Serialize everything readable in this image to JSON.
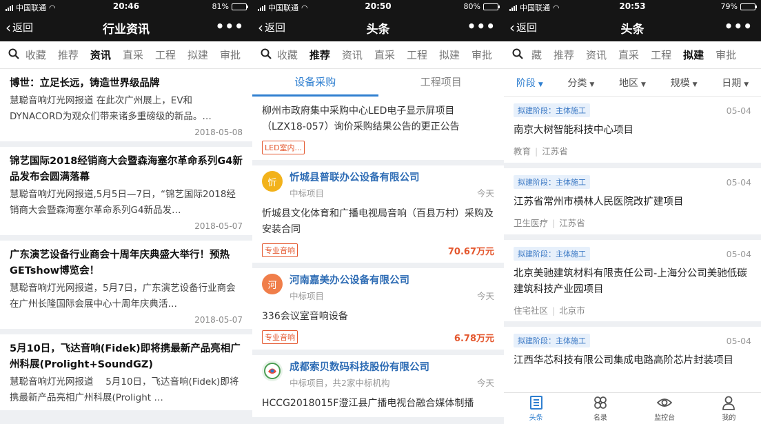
{
  "screens": [
    {
      "status": {
        "carrier": "中国联通",
        "time": "20:46",
        "battery": "81%",
        "battery_level": 0.81
      },
      "nav": {
        "back": "返回",
        "title": "行业资讯",
        "more": "•••"
      },
      "cats": [
        "收藏",
        "推荐",
        "资讯",
        "直采",
        "工程",
        "拟建",
        "审批"
      ],
      "active_cat": "资讯",
      "news": [
        {
          "title": "博世：立足长远，铸造世界级品牌",
          "desc": "慧聪音响灯光网报道 在此次广州展上，EV和DYNACORD为观众们带来诸多重磅级的新品。…",
          "date": "2018-05-08"
        },
        {
          "title": "锦艺国际2018经销商大会暨森海塞尔革命系列G4新品发布会圆满落幕",
          "desc": "慧聪音响灯光网报道,5月5日—7日，“锦艺国际2018经销商大会暨森海塞尔革命系列G4新品发…",
          "date": "2018-05-07"
        },
        {
          "title": "广东演艺设备行业商会十周年庆典盛大举行！预热GETshow博览会！",
          "desc": "慧聪音响灯光网报道，5月7日，广东演艺设备行业商会在广州长隆国际会展中心十周年庆典活…",
          "date": "2018-05-07"
        },
        {
          "title": "5月10日，飞达音响(Fidek)即将携最新产品亮相广州科展(Prolight+SoundGZ)",
          "desc": "慧聪音响灯光网报道　 5月10日，飞达音响(Fidek)即将携最新产品亮相广州科展(Prolight …",
          "date": ""
        }
      ]
    },
    {
      "status": {
        "carrier": "中国联通",
        "time": "20:50",
        "battery": "80%",
        "battery_level": 0.8
      },
      "nav": {
        "back": "返回",
        "title": "头条",
        "more": "•••"
      },
      "cats": [
        "收藏",
        "推荐",
        "资讯",
        "直采",
        "工程",
        "拟建",
        "审批"
      ],
      "active_cat": "推荐",
      "subtabs": [
        "设备采购",
        "工程项目"
      ],
      "partial": {
        "project": "柳州市政府集中采购中心LED电子显示屏项目（LZX18-057）询价采购结果公告的更正公告",
        "tag": "LED室内..."
      },
      "cards": [
        {
          "icon": "忻",
          "icon_color": "#f2b21b",
          "company": "忻城县普联办公设备有限公司",
          "sub": "中标项目",
          "when": "今天",
          "project": "忻城县文化体育和广播电视局音响（百县万村）采购及安装合同",
          "tag": "专业音响",
          "amount": "70.67万元"
        },
        {
          "icon": "河",
          "icon_color": "#f07e4a",
          "company": "河南嘉美办公设备有限公司",
          "sub": "中标项目",
          "when": "今天",
          "project": "336会议室音响设备",
          "tag": "专业音响",
          "amount": "6.78万元"
        },
        {
          "icon": "",
          "icon_color": "#e9f3ea",
          "company": "成都索贝数码科技股份有限公司",
          "sub": "中标项目，共2家中标机构",
          "when": "今天",
          "project": "HCCG2018015F澄江县广播电视台融合媒体制播",
          "tag": "",
          "amount": ""
        }
      ]
    },
    {
      "status": {
        "carrier": "中国联通",
        "time": "20:53",
        "battery": "79%",
        "battery_level": 0.79
      },
      "nav": {
        "back": "返回",
        "title": "头条",
        "more": "•••"
      },
      "cats": [
        "藏",
        "推荐",
        "资讯",
        "直采",
        "工程",
        "拟建",
        "审批"
      ],
      "active_cat": "拟建",
      "filters": [
        "阶段",
        "分类",
        "地区",
        "规模",
        "日期"
      ],
      "cards": [
        {
          "stage": "拟建阶段：主体施工",
          "date": "05-04",
          "title": "南京大树智能科技中心项目",
          "category": "教育",
          "region": "江苏省"
        },
        {
          "stage": "拟建阶段：主体施工",
          "date": "05-04",
          "title": "江苏省常州市横林人民医院改扩建项目",
          "category": "卫生医疗",
          "region": "江苏省"
        },
        {
          "stage": "拟建阶段：主体施工",
          "date": "05-04",
          "title": "北京美驰建筑材料有限责任公司-上海分公司美驰低碳建筑科技产业园项目",
          "category": "住宅社区",
          "region": "北京市"
        },
        {
          "stage": "拟建阶段：主体施工",
          "date": "05-04",
          "title": "江西华芯科技有限公司集成电路高阶芯片封装项目",
          "category": "",
          "region": ""
        }
      ],
      "tabbar": [
        "头条",
        "名录",
        "监控台",
        "我的"
      ]
    }
  ],
  "colors": {
    "accent": "#2f7fd0",
    "price": "#e4572e",
    "topbar": "#151515"
  }
}
